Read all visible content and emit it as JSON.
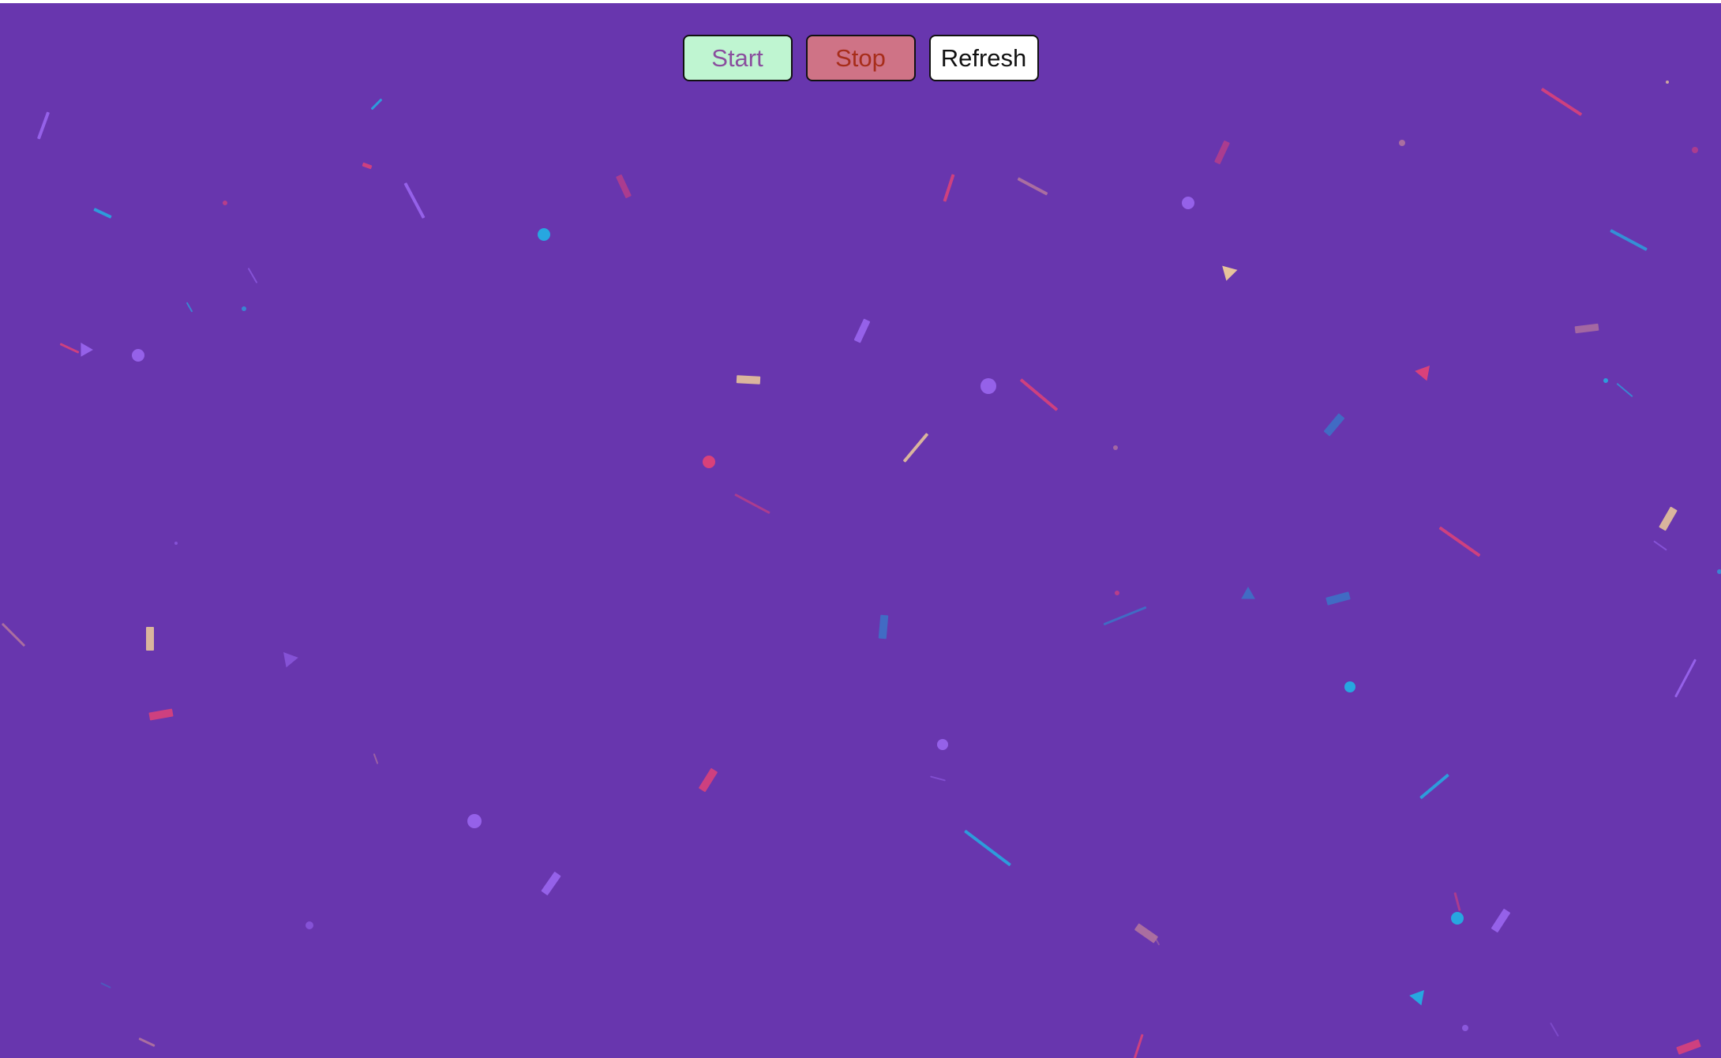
{
  "controls": {
    "start_label": "Start",
    "stop_label": "Stop",
    "refresh_label": "Refresh"
  },
  "colors": {
    "background": "#6836ae",
    "start_button_bg": "#bff5d1",
    "start_button_text": "#8a4e9e",
    "stop_button_bg": "#cf7386",
    "stop_button_text": "#a72d1a",
    "refresh_button_bg": "#ffffff",
    "confetti_palette": [
      "#d9417a",
      "#9a66f0",
      "#27a7e0",
      "#e7c39b",
      "#b1749f",
      "#3d71c6"
    ]
  },
  "confetti": {
    "shapes": [
      "strip",
      "bar",
      "dot",
      "triangle"
    ]
  }
}
